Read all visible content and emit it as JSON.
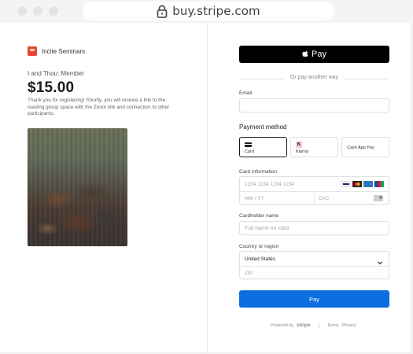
{
  "browser": {
    "url": "buy.stripe.com"
  },
  "merchant": {
    "name": "Incite Seminars"
  },
  "product": {
    "name": "I and Thou: Member",
    "price": "$15.00",
    "description": "Thank you for registering! Shortly, you will receive a link to the reading group space with the Zoom link and connection to other participants."
  },
  "checkout": {
    "apple_pay_label": "Pay",
    "or_text": "Or pay another way",
    "email_label": "Email",
    "email_value": "",
    "payment_method_title": "Payment method",
    "payment_methods": [
      {
        "label": "Card",
        "icon": "card-icon",
        "selected": true
      },
      {
        "label": "Klarna",
        "icon": "klarna-icon",
        "selected": false
      },
      {
        "label": "Cash App Pay",
        "icon": "",
        "selected": false
      }
    ],
    "card_info_label": "Card information",
    "card_number_placeholder": "1234 1234 1234 1234",
    "expiry_placeholder": "MM / YY",
    "cvc_placeholder": "CVC",
    "card_brands": [
      "visa",
      "mastercard",
      "amex",
      "jcb"
    ],
    "cardholder_label": "Cardholder name",
    "cardholder_placeholder": "Full name on card",
    "country_label": "Country or region",
    "country_value": "United States",
    "zip_placeholder": "ZIP",
    "pay_button_label": "Pay"
  },
  "footer": {
    "powered_by": "Powered by",
    "brand": "stripe",
    "terms": "Terms",
    "privacy": "Privacy"
  },
  "colors": {
    "pay_button": "#0b6fe0",
    "apple_pay_bg": "#000000",
    "merchant_logo": "#e9452f"
  }
}
